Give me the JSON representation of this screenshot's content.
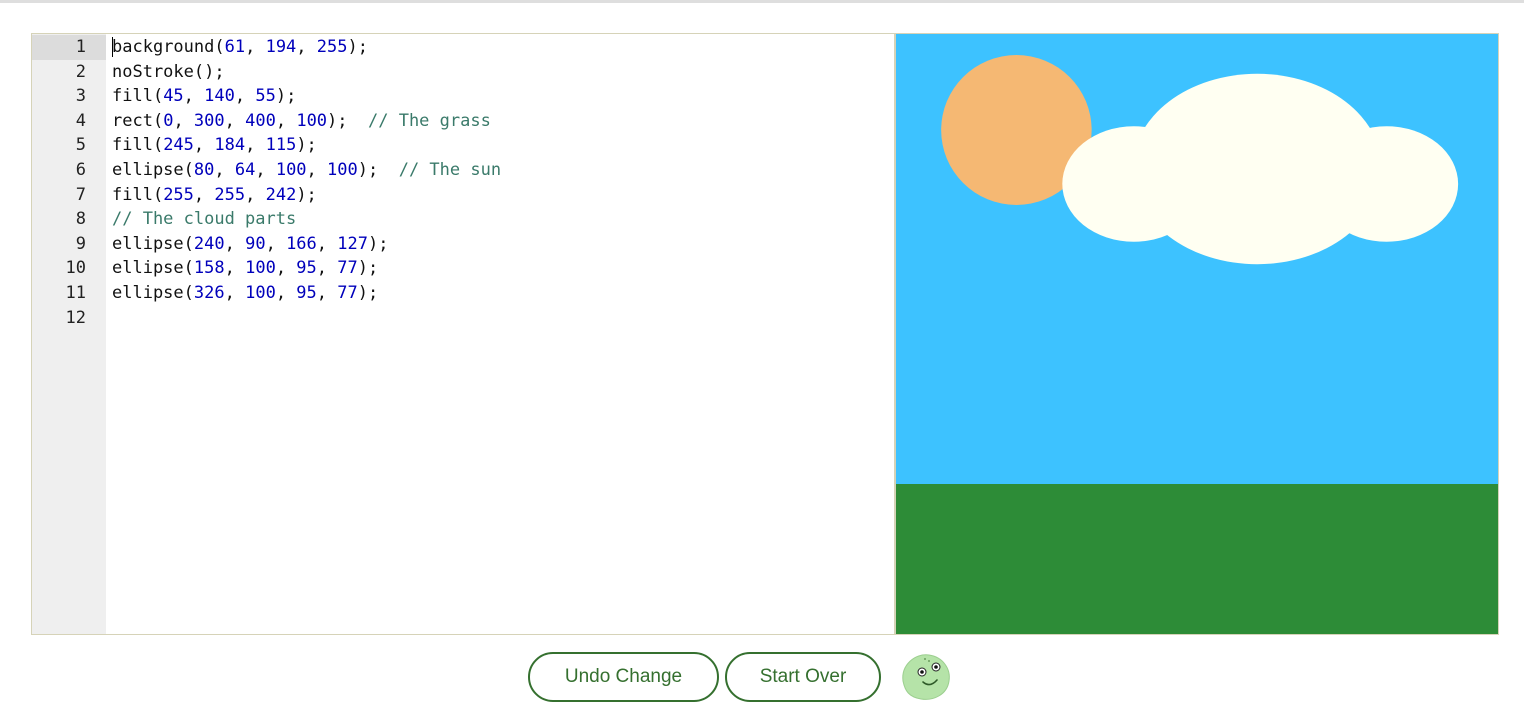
{
  "editor": {
    "line_numbers": [
      "1",
      "2",
      "3",
      "4",
      "5",
      "6",
      "7",
      "8",
      "9",
      "10",
      "11",
      "12"
    ],
    "active_line": 1,
    "lines": [
      [
        {
          "t": "b",
          "c": "fn"
        },
        {
          "t": "ackground(",
          "c": "fn"
        },
        {
          "t": "61",
          "c": "num"
        },
        {
          "t": ", ",
          "c": "fn"
        },
        {
          "t": "194",
          "c": "num"
        },
        {
          "t": ", ",
          "c": "fn"
        },
        {
          "t": "255",
          "c": "num"
        },
        {
          "t": ");",
          "c": "fn"
        }
      ],
      [
        {
          "t": "noStroke();",
          "c": "fn"
        }
      ],
      [
        {
          "t": "fill(",
          "c": "fn"
        },
        {
          "t": "45",
          "c": "num"
        },
        {
          "t": ", ",
          "c": "fn"
        },
        {
          "t": "140",
          "c": "num"
        },
        {
          "t": ", ",
          "c": "fn"
        },
        {
          "t": "55",
          "c": "num"
        },
        {
          "t": ");",
          "c": "fn"
        }
      ],
      [
        {
          "t": "rect(",
          "c": "fn"
        },
        {
          "t": "0",
          "c": "num"
        },
        {
          "t": ", ",
          "c": "fn"
        },
        {
          "t": "300",
          "c": "num"
        },
        {
          "t": ", ",
          "c": "fn"
        },
        {
          "t": "400",
          "c": "num"
        },
        {
          "t": ", ",
          "c": "fn"
        },
        {
          "t": "100",
          "c": "num"
        },
        {
          "t": ");  ",
          "c": "fn"
        },
        {
          "t": "// The grass",
          "c": "cm"
        }
      ],
      [
        {
          "t": "fill(",
          "c": "fn"
        },
        {
          "t": "245",
          "c": "num"
        },
        {
          "t": ", ",
          "c": "fn"
        },
        {
          "t": "184",
          "c": "num"
        },
        {
          "t": ", ",
          "c": "fn"
        },
        {
          "t": "115",
          "c": "num"
        },
        {
          "t": ");",
          "c": "fn"
        }
      ],
      [
        {
          "t": "ellipse(",
          "c": "fn"
        },
        {
          "t": "80",
          "c": "num"
        },
        {
          "t": ", ",
          "c": "fn"
        },
        {
          "t": "64",
          "c": "num"
        },
        {
          "t": ", ",
          "c": "fn"
        },
        {
          "t": "100",
          "c": "num"
        },
        {
          "t": ", ",
          "c": "fn"
        },
        {
          "t": "100",
          "c": "num"
        },
        {
          "t": ");  ",
          "c": "fn"
        },
        {
          "t": "// The sun",
          "c": "cm"
        }
      ],
      [
        {
          "t": "fill(",
          "c": "fn"
        },
        {
          "t": "255",
          "c": "num"
        },
        {
          "t": ", ",
          "c": "fn"
        },
        {
          "t": "255",
          "c": "num"
        },
        {
          "t": ", ",
          "c": "fn"
        },
        {
          "t": "242",
          "c": "num"
        },
        {
          "t": ");",
          "c": "fn"
        }
      ],
      [
        {
          "t": "// The cloud parts",
          "c": "cm"
        }
      ],
      [
        {
          "t": "ellipse(",
          "c": "fn"
        },
        {
          "t": "240",
          "c": "num"
        },
        {
          "t": ", ",
          "c": "fn"
        },
        {
          "t": "90",
          "c": "num"
        },
        {
          "t": ", ",
          "c": "fn"
        },
        {
          "t": "166",
          "c": "num"
        },
        {
          "t": ", ",
          "c": "fn"
        },
        {
          "t": "127",
          "c": "num"
        },
        {
          "t": ");",
          "c": "fn"
        }
      ],
      [
        {
          "t": "ellipse(",
          "c": "fn"
        },
        {
          "t": "158",
          "c": "num"
        },
        {
          "t": ", ",
          "c": "fn"
        },
        {
          "t": "100",
          "c": "num"
        },
        {
          "t": ", ",
          "c": "fn"
        },
        {
          "t": "95",
          "c": "num"
        },
        {
          "t": ", ",
          "c": "fn"
        },
        {
          "t": "77",
          "c": "num"
        },
        {
          "t": ");",
          "c": "fn"
        }
      ],
      [
        {
          "t": "ellipse(",
          "c": "fn"
        },
        {
          "t": "326",
          "c": "num"
        },
        {
          "t": ", ",
          "c": "fn"
        },
        {
          "t": "100",
          "c": "num"
        },
        {
          "t": ", ",
          "c": "fn"
        },
        {
          "t": "95",
          "c": "num"
        },
        {
          "t": ", ",
          "c": "fn"
        },
        {
          "t": "77",
          "c": "num"
        },
        {
          "t": ");",
          "c": "fn"
        }
      ],
      []
    ],
    "colors": {
      "fn": "#111111",
      "num": "#0000bb",
      "cm": "#3a7a6a"
    }
  },
  "canvas": {
    "background": "#3dc2ff",
    "grass_color": "#2d8c37",
    "sun_color": "#f5b873",
    "cloud_color": "#fffff2"
  },
  "buttons": {
    "undo_label": "Undo Change",
    "start_over_label": "Start Over"
  },
  "mascot": {
    "icon": "green-blob-mascot-icon",
    "color": "#b5e3a8"
  }
}
